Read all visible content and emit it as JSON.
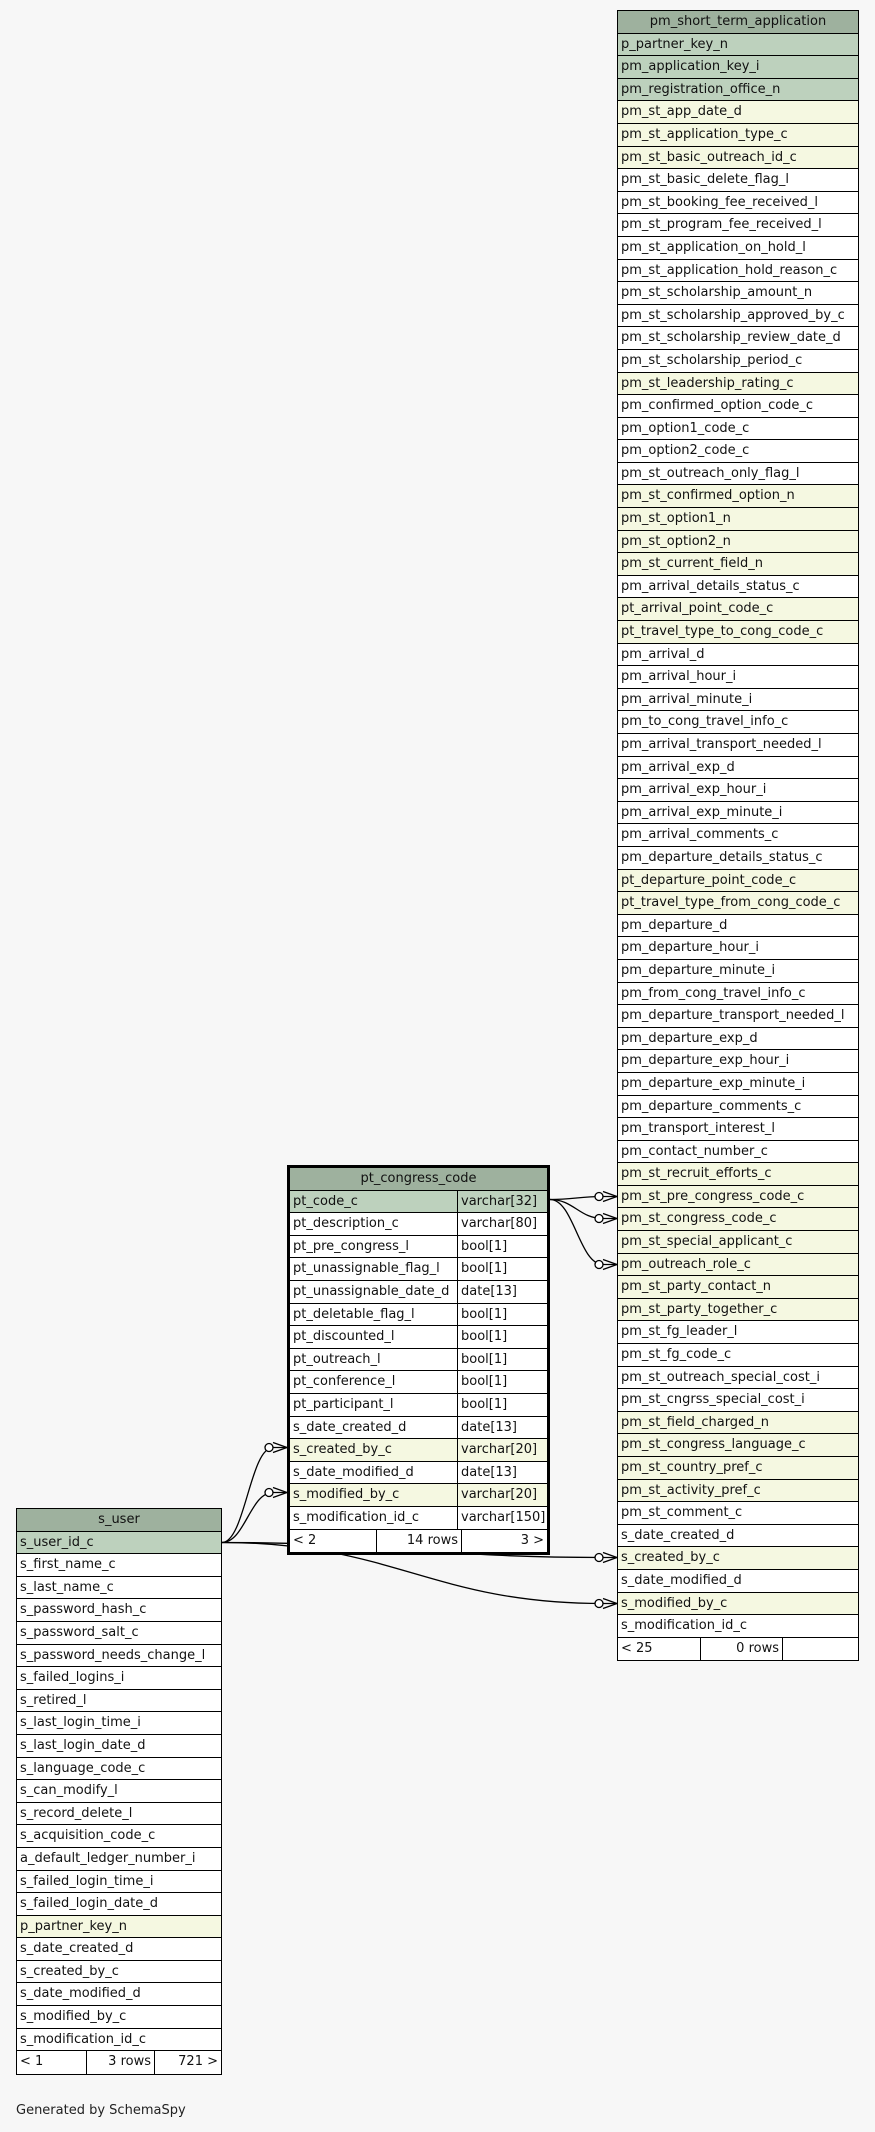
{
  "tables": {
    "pm_short_term_application": {
      "title": "pm_short_term_application",
      "columns": [
        {
          "name": "p_partner_key_n",
          "kind": "pk"
        },
        {
          "name": "pm_application_key_i",
          "kind": "pk"
        },
        {
          "name": "pm_registration_office_n",
          "kind": "pk"
        },
        {
          "name": "pm_st_app_date_d",
          "kind": "fk"
        },
        {
          "name": "pm_st_application_type_c",
          "kind": "fk"
        },
        {
          "name": "pm_st_basic_outreach_id_c",
          "kind": "fk"
        },
        {
          "name": "pm_st_basic_delete_flag_l",
          "kind": ""
        },
        {
          "name": "pm_st_booking_fee_received_l",
          "kind": ""
        },
        {
          "name": "pm_st_program_fee_received_l",
          "kind": ""
        },
        {
          "name": "pm_st_application_on_hold_l",
          "kind": ""
        },
        {
          "name": "pm_st_application_hold_reason_c",
          "kind": ""
        },
        {
          "name": "pm_st_scholarship_amount_n",
          "kind": ""
        },
        {
          "name": "pm_st_scholarship_approved_by_c",
          "kind": ""
        },
        {
          "name": "pm_st_scholarship_review_date_d",
          "kind": ""
        },
        {
          "name": "pm_st_scholarship_period_c",
          "kind": ""
        },
        {
          "name": "pm_st_leadership_rating_c",
          "kind": "fk"
        },
        {
          "name": "pm_confirmed_option_code_c",
          "kind": ""
        },
        {
          "name": "pm_option1_code_c",
          "kind": ""
        },
        {
          "name": "pm_option2_code_c",
          "kind": ""
        },
        {
          "name": "pm_st_outreach_only_flag_l",
          "kind": ""
        },
        {
          "name": "pm_st_confirmed_option_n",
          "kind": "fk"
        },
        {
          "name": "pm_st_option1_n",
          "kind": "fk"
        },
        {
          "name": "pm_st_option2_n",
          "kind": "fk"
        },
        {
          "name": "pm_st_current_field_n",
          "kind": "fk"
        },
        {
          "name": "pm_arrival_details_status_c",
          "kind": ""
        },
        {
          "name": "pt_arrival_point_code_c",
          "kind": "fk"
        },
        {
          "name": "pt_travel_type_to_cong_code_c",
          "kind": "fk"
        },
        {
          "name": "pm_arrival_d",
          "kind": ""
        },
        {
          "name": "pm_arrival_hour_i",
          "kind": ""
        },
        {
          "name": "pm_arrival_minute_i",
          "kind": ""
        },
        {
          "name": "pm_to_cong_travel_info_c",
          "kind": ""
        },
        {
          "name": "pm_arrival_transport_needed_l",
          "kind": ""
        },
        {
          "name": "pm_arrival_exp_d",
          "kind": ""
        },
        {
          "name": "pm_arrival_exp_hour_i",
          "kind": ""
        },
        {
          "name": "pm_arrival_exp_minute_i",
          "kind": ""
        },
        {
          "name": "pm_arrival_comments_c",
          "kind": ""
        },
        {
          "name": "pm_departure_details_status_c",
          "kind": ""
        },
        {
          "name": "pt_departure_point_code_c",
          "kind": "fk"
        },
        {
          "name": "pt_travel_type_from_cong_code_c",
          "kind": "fk"
        },
        {
          "name": "pm_departure_d",
          "kind": ""
        },
        {
          "name": "pm_departure_hour_i",
          "kind": ""
        },
        {
          "name": "pm_departure_minute_i",
          "kind": ""
        },
        {
          "name": "pm_from_cong_travel_info_c",
          "kind": ""
        },
        {
          "name": "pm_departure_transport_needed_l",
          "kind": ""
        },
        {
          "name": "pm_departure_exp_d",
          "kind": ""
        },
        {
          "name": "pm_departure_exp_hour_i",
          "kind": ""
        },
        {
          "name": "pm_departure_exp_minute_i",
          "kind": ""
        },
        {
          "name": "pm_departure_comments_c",
          "kind": ""
        },
        {
          "name": "pm_transport_interest_l",
          "kind": ""
        },
        {
          "name": "pm_contact_number_c",
          "kind": ""
        },
        {
          "name": "pm_st_recruit_efforts_c",
          "kind": "fk"
        },
        {
          "name": "pm_st_pre_congress_code_c",
          "kind": "fk"
        },
        {
          "name": "pm_st_congress_code_c",
          "kind": "fk"
        },
        {
          "name": "pm_st_special_applicant_c",
          "kind": "fk"
        },
        {
          "name": "pm_outreach_role_c",
          "kind": "fk"
        },
        {
          "name": "pm_st_party_contact_n",
          "kind": "fk"
        },
        {
          "name": "pm_st_party_together_c",
          "kind": "fk"
        },
        {
          "name": "pm_st_fg_leader_l",
          "kind": ""
        },
        {
          "name": "pm_st_fg_code_c",
          "kind": ""
        },
        {
          "name": "pm_st_outreach_special_cost_i",
          "kind": ""
        },
        {
          "name": "pm_st_cngrss_special_cost_i",
          "kind": ""
        },
        {
          "name": "pm_st_field_charged_n",
          "kind": "fk"
        },
        {
          "name": "pm_st_congress_language_c",
          "kind": "fk"
        },
        {
          "name": "pm_st_country_pref_c",
          "kind": "fk"
        },
        {
          "name": "pm_st_activity_pref_c",
          "kind": "fk"
        },
        {
          "name": "pm_st_comment_c",
          "kind": ""
        },
        {
          "name": "s_date_created_d",
          "kind": ""
        },
        {
          "name": "s_created_by_c",
          "kind": "fk"
        },
        {
          "name": "s_date_modified_d",
          "kind": ""
        },
        {
          "name": "s_modified_by_c",
          "kind": "fk"
        },
        {
          "name": "s_modification_id_c",
          "kind": ""
        }
      ],
      "footer": [
        "< 25",
        "0 rows",
        ""
      ]
    },
    "pt_congress_code": {
      "title": "pt_congress_code",
      "columns": [
        {
          "name": "pt_code_c",
          "type": "varchar[32]",
          "kind": "pk"
        },
        {
          "name": "pt_description_c",
          "type": "varchar[80]",
          "kind": ""
        },
        {
          "name": "pt_pre_congress_l",
          "type": "bool[1]",
          "kind": ""
        },
        {
          "name": "pt_unassignable_flag_l",
          "type": "bool[1]",
          "kind": ""
        },
        {
          "name": "pt_unassignable_date_d",
          "type": "date[13]",
          "kind": ""
        },
        {
          "name": "pt_deletable_flag_l",
          "type": "bool[1]",
          "kind": ""
        },
        {
          "name": "pt_discounted_l",
          "type": "bool[1]",
          "kind": ""
        },
        {
          "name": "pt_outreach_l",
          "type": "bool[1]",
          "kind": ""
        },
        {
          "name": "pt_conference_l",
          "type": "bool[1]",
          "kind": ""
        },
        {
          "name": "pt_participant_l",
          "type": "bool[1]",
          "kind": ""
        },
        {
          "name": "s_date_created_d",
          "type": "date[13]",
          "kind": ""
        },
        {
          "name": "s_created_by_c",
          "type": "varchar[20]",
          "kind": "fk"
        },
        {
          "name": "s_date_modified_d",
          "type": "date[13]",
          "kind": ""
        },
        {
          "name": "s_modified_by_c",
          "type": "varchar[20]",
          "kind": "fk"
        },
        {
          "name": "s_modification_id_c",
          "type": "varchar[150]",
          "kind": ""
        }
      ],
      "footer": [
        "< 2",
        "14 rows",
        "3 >"
      ]
    },
    "s_user": {
      "title": "s_user",
      "columns": [
        {
          "name": "s_user_id_c",
          "kind": "pk"
        },
        {
          "name": "s_first_name_c",
          "kind": ""
        },
        {
          "name": "s_last_name_c",
          "kind": ""
        },
        {
          "name": "s_password_hash_c",
          "kind": ""
        },
        {
          "name": "s_password_salt_c",
          "kind": ""
        },
        {
          "name": "s_password_needs_change_l",
          "kind": ""
        },
        {
          "name": "s_failed_logins_i",
          "kind": ""
        },
        {
          "name": "s_retired_l",
          "kind": ""
        },
        {
          "name": "s_last_login_time_i",
          "kind": ""
        },
        {
          "name": "s_last_login_date_d",
          "kind": ""
        },
        {
          "name": "s_language_code_c",
          "kind": ""
        },
        {
          "name": "s_can_modify_l",
          "kind": ""
        },
        {
          "name": "s_record_delete_l",
          "kind": ""
        },
        {
          "name": "s_acquisition_code_c",
          "kind": ""
        },
        {
          "name": "a_default_ledger_number_i",
          "kind": ""
        },
        {
          "name": "s_failed_login_time_i",
          "kind": ""
        },
        {
          "name": "s_failed_login_date_d",
          "kind": ""
        },
        {
          "name": "p_partner_key_n",
          "kind": "fk"
        },
        {
          "name": "s_date_created_d",
          "kind": ""
        },
        {
          "name": "s_created_by_c",
          "kind": ""
        },
        {
          "name": "s_date_modified_d",
          "kind": ""
        },
        {
          "name": "s_modified_by_c",
          "kind": ""
        },
        {
          "name": "s_modification_id_c",
          "kind": ""
        }
      ],
      "footer": [
        "< 1",
        "3 rows",
        "721 >"
      ]
    }
  },
  "credit": "Generated by SchemaSpy"
}
